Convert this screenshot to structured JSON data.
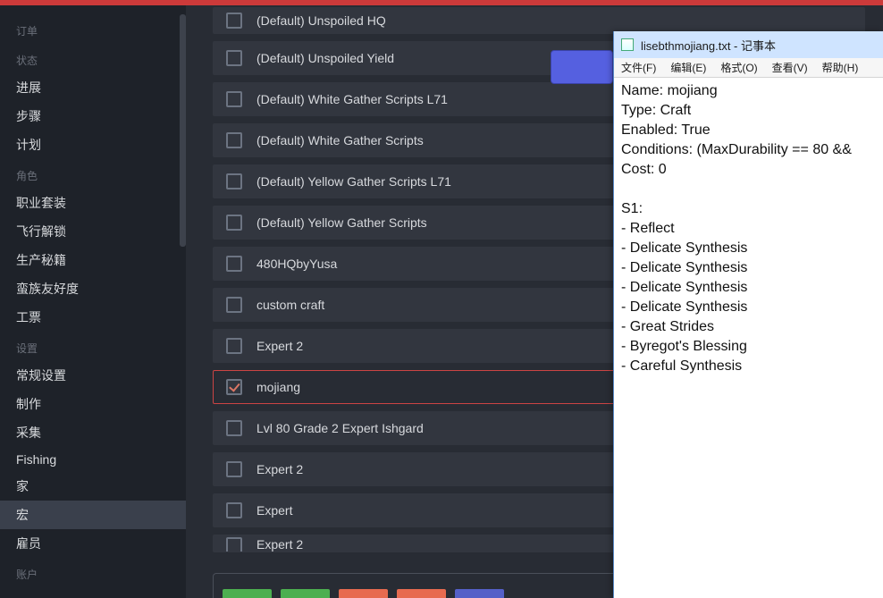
{
  "sidebar": {
    "groups": [
      {
        "title": "订单",
        "items": []
      },
      {
        "title": "状态",
        "items": [
          "进展",
          "步骤",
          "计划"
        ]
      },
      {
        "title": "角色",
        "items": [
          "职业套装",
          "飞行解锁",
          "生产秘籍",
          "蛮族友好度",
          "工票"
        ]
      },
      {
        "title": "设置",
        "items": [
          "常规设置",
          "制作",
          "采集",
          "Fishing",
          "家",
          "宏",
          "雇员"
        ],
        "active_index": 5
      },
      {
        "title": "账户",
        "items": []
      }
    ]
  },
  "rows": [
    {
      "label": "(Default) Unspoiled HQ",
      "checked": false,
      "cut": "top"
    },
    {
      "label": "(Default) Unspoiled Yield",
      "checked": false
    },
    {
      "label": "(Default) White Gather Scripts L71",
      "checked": false
    },
    {
      "label": "(Default) White Gather Scripts",
      "checked": false
    },
    {
      "label": "(Default) Yellow Gather Scripts L71",
      "checked": false
    },
    {
      "label": "(Default) Yellow Gather Scripts",
      "checked": false
    },
    {
      "label": "480HQbyYusa",
      "checked": false
    },
    {
      "label": "custom craft",
      "checked": false
    },
    {
      "label": "Expert 2",
      "checked": false
    },
    {
      "label": "mojiang",
      "checked": true,
      "selected": true
    },
    {
      "label": "Lvl 80 Grade 2 Expert Ishgard",
      "checked": false
    },
    {
      "label": "Expert 2",
      "checked": false
    },
    {
      "label": "Expert",
      "checked": false
    },
    {
      "label": "Expert 2",
      "checked": false,
      "cut": "bottom"
    }
  ],
  "notepad": {
    "title": "lisebthmojiang.txt - 记事本",
    "menu": [
      "文件(F)",
      "编辑(E)",
      "格式(O)",
      "查看(V)",
      "帮助(H)"
    ],
    "body": "Name: mojiang\nType: Craft\nEnabled: True\nConditions: (MaxDurability == 80 && \nCost: 0\n\nS1:\n- Reflect\n- Delicate Synthesis\n- Delicate Synthesis\n- Delicate Synthesis\n- Delicate Synthesis\n- Great Strides\n- Byregot's Blessing\n- Careful Synthesis"
  }
}
